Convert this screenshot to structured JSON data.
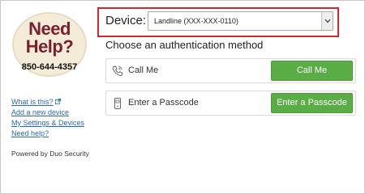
{
  "logo": {
    "line1": "Need",
    "line2": "Help?",
    "phone": "850-644-4357"
  },
  "sidebar": {
    "links": [
      {
        "label": "What is this?"
      },
      {
        "label": "Add a new device"
      },
      {
        "label": "My Settings & Devices"
      },
      {
        "label": "Need help?"
      }
    ],
    "powered_by": "Powered by Duo Security"
  },
  "device": {
    "label": "Device:",
    "selected": "Landline (XXX-XXX-0110)"
  },
  "main": {
    "heading": "Choose an authentication method",
    "methods": [
      {
        "label": "Call Me",
        "button": "Call Me",
        "icon": "phone-icon"
      },
      {
        "label": "Enter a Passcode",
        "button": "Enter a Passcode",
        "icon": "passcode-device-icon"
      }
    ]
  },
  "colors": {
    "button_green": "#5aac44",
    "highlight_red": "#d9232e",
    "link_blue": "#2a6ab4",
    "logo_maroon": "#7a1f2e"
  }
}
